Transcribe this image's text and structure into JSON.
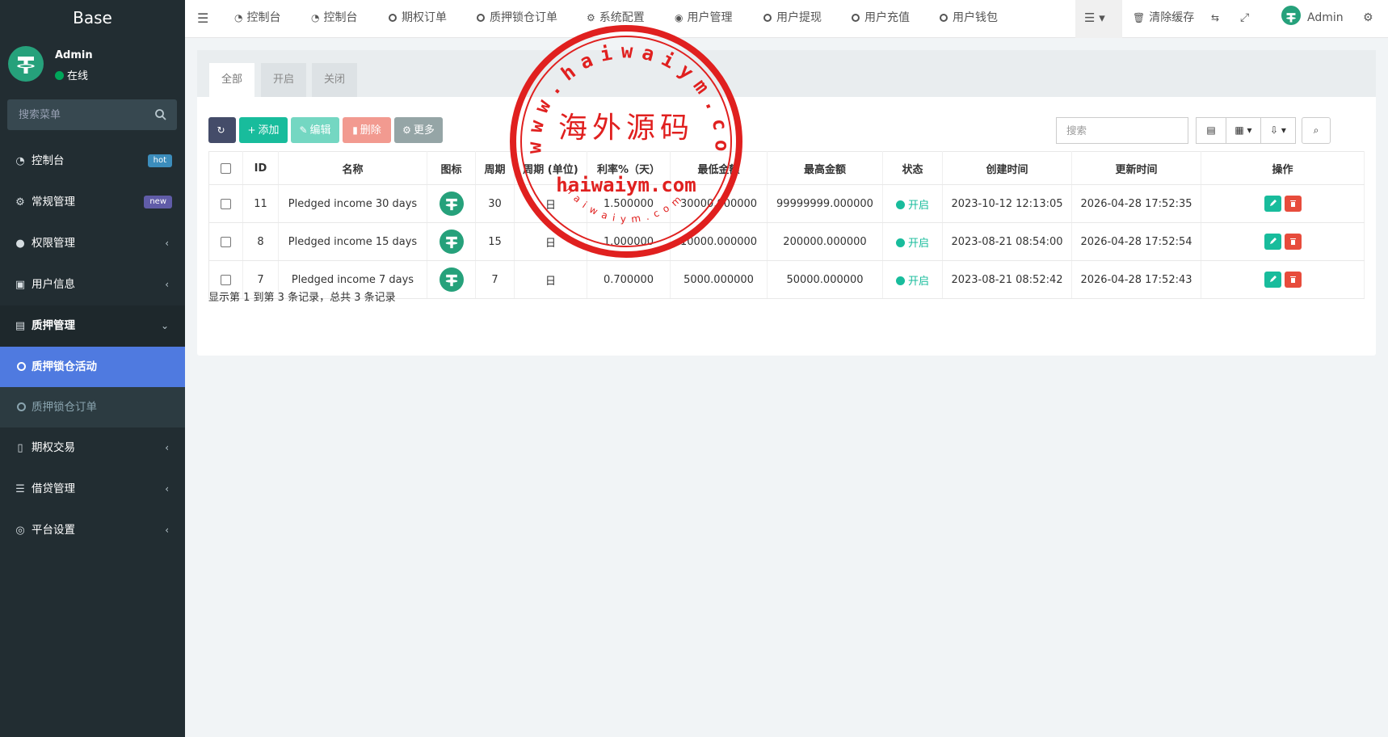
{
  "brand": {
    "title": "Base"
  },
  "user": {
    "name": "Admin",
    "status": "在线"
  },
  "sidebar": {
    "search_placeholder": "搜索菜单",
    "items": [
      {
        "label": "控制台",
        "icon": "dashboard-icon",
        "badge": "hot",
        "badge_color": "#3c8dbc"
      },
      {
        "label": "常规管理",
        "icon": "cogs-icon",
        "badge": "new",
        "badge_color": "#605ca8"
      },
      {
        "label": "权限管理",
        "icon": "group-icon"
      },
      {
        "label": "用户信息",
        "icon": "download-icon"
      },
      {
        "label": "质押管理",
        "icon": "newspaper-icon",
        "expanded": true,
        "children": [
          {
            "label": "质押锁仓活动",
            "active": true
          },
          {
            "label": "质押锁仓订单"
          }
        ]
      },
      {
        "label": "期权交易",
        "icon": "file-icon"
      },
      {
        "label": "借贷管理",
        "icon": "list-icon"
      },
      {
        "label": "平台设置",
        "icon": "dot-circle-icon"
      }
    ]
  },
  "topnav": {
    "items": [
      {
        "label": "控制台"
      },
      {
        "label": "控制台"
      },
      {
        "label": "期权订单"
      },
      {
        "label": "质押锁仓订单"
      },
      {
        "label": "系统配置"
      },
      {
        "label": "用户管理"
      },
      {
        "label": "用户提现"
      },
      {
        "label": "用户充值"
      },
      {
        "label": "用户钱包"
      }
    ],
    "clear_cache": "清除缓存",
    "admin": "Admin"
  },
  "tabs": [
    "全部",
    "开启",
    "关闭"
  ],
  "toolbar": {
    "add": "添加",
    "edit": "编辑",
    "delete": "删除",
    "more": "更多",
    "search_placeholder": "搜索"
  },
  "table": {
    "headers": [
      "ID",
      "名称",
      "图标",
      "周期",
      "周期 (单位)",
      "利率%（天）",
      "最低金额",
      "最高金额",
      "状态",
      "创建时间",
      "更新时间",
      "操作"
    ],
    "rows": [
      {
        "id": "11",
        "name": "Pledged income 30 days",
        "period": "30",
        "unit": "日",
        "rate": "1.500000",
        "min": "30000.000000",
        "max": "99999999.000000",
        "status": "开启",
        "created": "2023-10-12 12:13:05",
        "updated": "2026-04-28 17:52:35"
      },
      {
        "id": "8",
        "name": "Pledged income 15 days",
        "period": "15",
        "unit": "日",
        "rate": "1.000000",
        "min": "10000.000000",
        "max": "200000.000000",
        "status": "开启",
        "created": "2023-08-21 08:54:00",
        "updated": "2026-04-28 17:52:54"
      },
      {
        "id": "7",
        "name": "Pledged income 7 days",
        "period": "7",
        "unit": "日",
        "rate": "0.700000",
        "min": "5000.000000",
        "max": "50000.000000",
        "status": "开启",
        "created": "2023-08-21 08:52:42",
        "updated": "2026-04-28 17:52:43"
      }
    ]
  },
  "pager": {
    "summary": "显示第 1 到第 3 条记录，总共 3 条记录"
  },
  "watermark": {
    "top": "www.haiwaiym.com",
    "center": "海外源码",
    "bottom_big": "haiwaiym.com",
    "bottom_small": "haiwaiym.com",
    "color": "#e0201f"
  },
  "colors": {
    "sidebar_bg": "#222d32",
    "active_menu": "#4f7ae0",
    "success": "#18bc9c",
    "danger": "#e74c3c",
    "tether": "#26a17b"
  }
}
